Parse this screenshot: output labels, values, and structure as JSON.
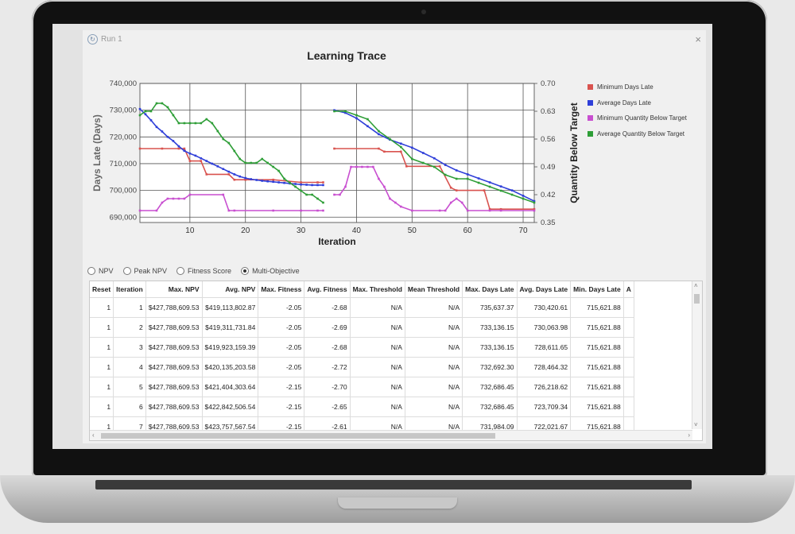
{
  "window": {
    "title": "Run 1",
    "close_label": "×"
  },
  "chart": {
    "title": "Learning Trace"
  },
  "chart_data": {
    "type": "line",
    "title": "Learning Trace",
    "xlabel": "Iteration",
    "ylabel": "Days Late (Days)",
    "y2label": "Quantity Below Target",
    "xlim": [
      1,
      72
    ],
    "ylim": [
      688000,
      740000
    ],
    "y2lim": [
      0.35,
      0.7
    ],
    "xticks": [
      10,
      20,
      30,
      40,
      50,
      60,
      70
    ],
    "yticks": [
      "740,000",
      "730,000",
      "720,000",
      "710,000",
      "700,000",
      "690,000"
    ],
    "y2ticks": [
      "0.70",
      "0.63",
      "0.56",
      "0.49",
      "0.42",
      "0.35"
    ],
    "grid": true,
    "legend_position": "right",
    "series": [
      {
        "name": "Minimum Days Late",
        "axis": "left",
        "color": "#d9534f",
        "segments": [
          {
            "x": [
              1,
              5,
              8,
              9,
              10,
              12,
              13,
              17,
              18,
              20,
              25,
              30,
              33,
              34
            ],
            "y": [
              715622,
              715622,
              715622,
              715622,
              711000,
              711000,
              706000,
              706000,
              704000,
              704000,
              704000,
              703000,
              703000,
              703000
            ]
          },
          {
            "x": [
              36,
              44,
              45,
              48,
              49,
              55,
              57,
              58,
              63,
              64,
              66,
              72
            ],
            "y": [
              715622,
              715622,
              714500,
              714500,
              709000,
              709000,
              701000,
              700000,
              700000,
              693000,
              693000,
              693000
            ]
          }
        ]
      },
      {
        "name": "Average Days Late",
        "axis": "left",
        "color": "#2f3fd9",
        "segments": [
          {
            "x": [
              1,
              2,
              3,
              4,
              5,
              6,
              7,
              8,
              9,
              10,
              11,
              12,
              13,
              14,
              15,
              16,
              17,
              18,
              19,
              20,
              21,
              22,
              23,
              24,
              25,
              26,
              27,
              28,
              29,
              30,
              31,
              32,
              33,
              34
            ],
            "y": [
              730421,
              728464,
              726219,
              723709,
              722022,
              720000,
              718500,
              716500,
              714800,
              713800,
              713000,
              712000,
              711000,
              710000,
              709000,
              708000,
              707000,
              706000,
              705200,
              704600,
              704200,
              703900,
              703600,
              703400,
              703200,
              703000,
              702800,
              702600,
              702400,
              702200,
              702100,
              702000,
              702000,
              702000
            ]
          },
          {
            "x": [
              36,
              38,
              40,
              42,
              44,
              46,
              48,
              50,
              52,
              54,
              56,
              58,
              60,
              62,
              64,
              66,
              68,
              70,
              72
            ],
            "y": [
              730000,
              729000,
              727000,
              724000,
              721000,
              719000,
              717500,
              716000,
              714000,
              712000,
              709500,
              707500,
              706000,
              704500,
              703000,
              701500,
              700000,
              698000,
              696000
            ]
          }
        ]
      },
      {
        "name": "Minimum Quantity Below Target",
        "axis": "right",
        "color": "#c84fd0",
        "segments": [
          {
            "x": [
              1,
              4,
              5,
              6,
              7,
              8,
              9,
              10,
              16,
              17,
              18,
              25,
              30,
              33,
              34
            ],
            "y": [
              0.38,
              0.38,
              0.4,
              0.41,
              0.41,
              0.41,
              0.41,
              0.42,
              0.42,
              0.38,
              0.38,
              0.38,
              0.38,
              0.38,
              0.38
            ]
          },
          {
            "x": [
              36,
              37,
              38,
              39,
              40,
              41,
              42,
              43,
              44,
              45,
              46,
              47,
              48,
              50,
              55,
              56,
              57,
              58,
              59,
              60,
              64,
              66,
              72
            ],
            "y": [
              0.42,
              0.42,
              0.44,
              0.49,
              0.49,
              0.49,
              0.49,
              0.49,
              0.46,
              0.44,
              0.41,
              0.4,
              0.39,
              0.38,
              0.38,
              0.38,
              0.4,
              0.41,
              0.4,
              0.38,
              0.38,
              0.38,
              0.38
            ]
          }
        ]
      },
      {
        "name": "Average Quantity Below Target",
        "axis": "right",
        "color": "#2e9e37",
        "segments": [
          {
            "x": [
              1,
              2,
              3,
              4,
              5,
              6,
              7,
              8,
              9,
              10,
              11,
              12,
              13,
              14,
              15,
              16,
              17,
              18,
              19,
              20,
              21,
              22,
              23,
              24,
              25,
              26,
              27,
              28,
              29,
              30,
              31,
              32,
              33,
              34
            ],
            "y": [
              0.62,
              0.63,
              0.63,
              0.65,
              0.65,
              0.64,
              0.62,
              0.6,
              0.6,
              0.6,
              0.6,
              0.6,
              0.61,
              0.6,
              0.58,
              0.56,
              0.55,
              0.53,
              0.51,
              0.5,
              0.5,
              0.5,
              0.51,
              0.5,
              0.49,
              0.48,
              0.46,
              0.45,
              0.44,
              0.43,
              0.42,
              0.42,
              0.41,
              0.4
            ]
          },
          {
            "x": [
              36,
              38,
              40,
              42,
              44,
              46,
              48,
              50,
              52,
              54,
              56,
              58,
              60,
              62,
              64,
              66,
              68,
              70,
              72
            ],
            "y": [
              0.63,
              0.63,
              0.62,
              0.61,
              0.58,
              0.56,
              0.54,
              0.51,
              0.5,
              0.49,
              0.47,
              0.46,
              0.46,
              0.45,
              0.44,
              0.43,
              0.42,
              0.41,
              0.4
            ]
          }
        ]
      }
    ]
  },
  "options": [
    {
      "label": "NPV",
      "checked": false
    },
    {
      "label": "Peak NPV",
      "checked": false
    },
    {
      "label": "Fitness Score",
      "checked": false
    },
    {
      "label": "Multi-Objective",
      "checked": true
    }
  ],
  "table": {
    "columns": [
      "Reset",
      "Iteration",
      "Max. NPV",
      "Avg. NPV",
      "Max. Fitness",
      "Avg. Fitness",
      "Max. Threshold",
      "Mean Threshold",
      "Max. Days Late",
      "Avg. Days Late",
      "Min. Days Late",
      "A"
    ],
    "rows": [
      [
        "1",
        "1",
        "$427,788,609.53",
        "$419,113,802.87",
        "-2.05",
        "-2.68",
        "N/A",
        "N/A",
        "735,637.37",
        "730,420.61",
        "715,621.88",
        ""
      ],
      [
        "1",
        "2",
        "$427,788,609.53",
        "$419,311,731.84",
        "-2.05",
        "-2.69",
        "N/A",
        "N/A",
        "733,136.15",
        "730,063.98",
        "715,621.88",
        ""
      ],
      [
        "1",
        "3",
        "$427,788,609.53",
        "$419,923,159.39",
        "-2.05",
        "-2.68",
        "N/A",
        "N/A",
        "733,136.15",
        "728,611.65",
        "715,621.88",
        ""
      ],
      [
        "1",
        "4",
        "$427,788,609.53",
        "$420,135,203.58",
        "-2.05",
        "-2.72",
        "N/A",
        "N/A",
        "732,692.30",
        "728,464.32",
        "715,621.88",
        ""
      ],
      [
        "1",
        "5",
        "$427,788,609.53",
        "$421,404,303.64",
        "-2.15",
        "-2.70",
        "N/A",
        "N/A",
        "732,686.45",
        "726,218.62",
        "715,621.88",
        ""
      ],
      [
        "1",
        "6",
        "$427,788,609.53",
        "$422,842,506.54",
        "-2.15",
        "-2.65",
        "N/A",
        "N/A",
        "732,686.45",
        "723,709.34",
        "715,621.88",
        ""
      ],
      [
        "1",
        "7",
        "$427,788,609.53",
        "$423,757,567.54",
        "-2.15",
        "-2.61",
        "N/A",
        "N/A",
        "731,984.09",
        "722,021.67",
        "715,621.88",
        ""
      ]
    ]
  }
}
